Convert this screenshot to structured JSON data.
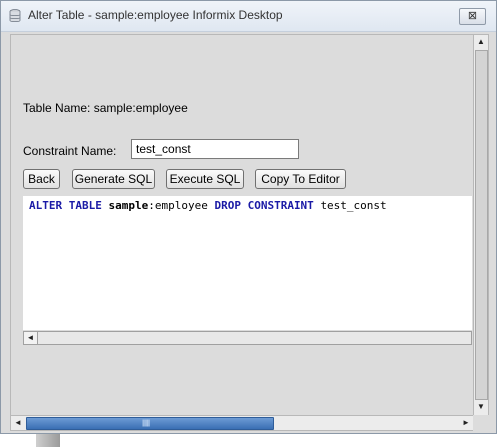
{
  "window": {
    "title": "Alter Table - sample:employee Informix Desktop",
    "close_glyph": "⊠",
    "app_icon": "database-icon"
  },
  "form": {
    "table_name_label": "Table Name: sample:employee",
    "constraint_name_label": "Constraint Name:",
    "constraint_name_value": "test_const"
  },
  "buttons": {
    "back": "Back",
    "generate_sql": "Generate SQL",
    "execute_sql": "Execute SQL",
    "copy_to_editor": "Copy To Editor"
  },
  "sql": {
    "kw_alter_table": "ALTER TABLE",
    "db_name": "sample",
    "separator": ":",
    "table": "employee",
    "kw_drop_constraint": "DROP CONSTRAINT",
    "constraint": "test_const"
  },
  "colors": {
    "keyword": "#1a1aa6",
    "scroll_thumb": "#3a6fb3",
    "window_background": "#dcdcdc"
  },
  "scrollbars": {
    "up_arrow": "▲",
    "down_arrow": "▼",
    "left_arrow": "◄",
    "right_arrow": "►",
    "grip": "|||||||||"
  }
}
